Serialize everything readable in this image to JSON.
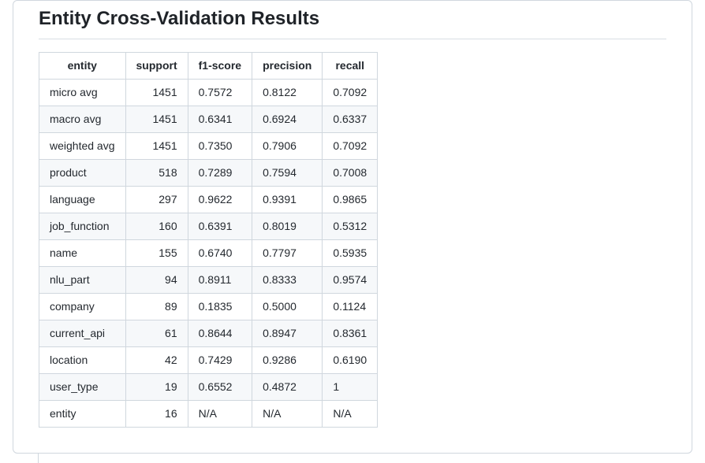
{
  "heading": "Entity Cross-Validation Results",
  "table": {
    "headers": {
      "entity": "entity",
      "support": "support",
      "f1": "f1-score",
      "precision": "precision",
      "recall": "recall"
    },
    "rows": [
      {
        "entity": "micro avg",
        "support": "1451",
        "f1": "0.7572",
        "precision": "0.8122",
        "recall": "0.7092"
      },
      {
        "entity": "macro avg",
        "support": "1451",
        "f1": "0.6341",
        "precision": "0.6924",
        "recall": "0.6337"
      },
      {
        "entity": "weighted avg",
        "support": "1451",
        "f1": "0.7350",
        "precision": "0.7906",
        "recall": "0.7092"
      },
      {
        "entity": "product",
        "support": "518",
        "f1": "0.7289",
        "precision": "0.7594",
        "recall": "0.7008"
      },
      {
        "entity": "language",
        "support": "297",
        "f1": "0.9622",
        "precision": "0.9391",
        "recall": "0.9865"
      },
      {
        "entity": "job_function",
        "support": "160",
        "f1": "0.6391",
        "precision": "0.8019",
        "recall": "0.5312"
      },
      {
        "entity": "name",
        "support": "155",
        "f1": "0.6740",
        "precision": "0.7797",
        "recall": "0.5935"
      },
      {
        "entity": "nlu_part",
        "support": "94",
        "f1": "0.8911",
        "precision": "0.8333",
        "recall": "0.9574"
      },
      {
        "entity": "company",
        "support": "89",
        "f1": "0.1835",
        "precision": "0.5000",
        "recall": "0.1124"
      },
      {
        "entity": "current_api",
        "support": "61",
        "f1": "0.8644",
        "precision": "0.8947",
        "recall": "0.8361"
      },
      {
        "entity": "location",
        "support": "42",
        "f1": "0.7429",
        "precision": "0.9286",
        "recall": "0.6190"
      },
      {
        "entity": "user_type",
        "support": "19",
        "f1": "0.6552",
        "precision": "0.4872",
        "recall": "1"
      },
      {
        "entity": "entity",
        "support": "16",
        "f1": "N/A",
        "precision": "N/A",
        "recall": "N/A"
      }
    ]
  }
}
